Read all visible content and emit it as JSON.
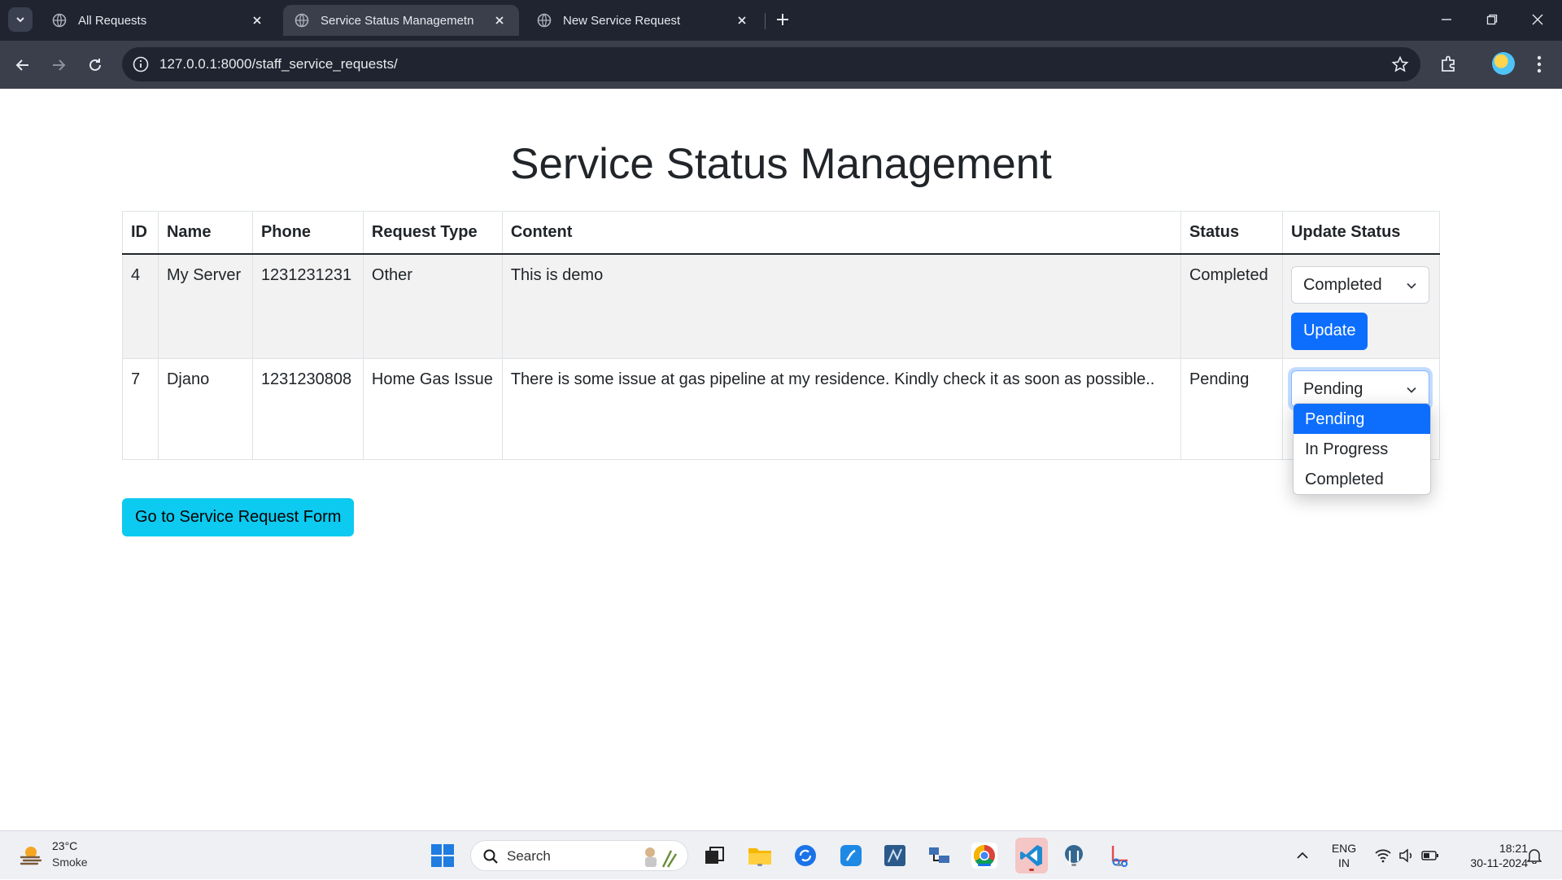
{
  "browser": {
    "tabs": [
      {
        "title": "All Requests",
        "active": false
      },
      {
        "title": "Service Status Managemetn",
        "active": true
      },
      {
        "title": "New Service Request",
        "active": false
      }
    ],
    "url": "127.0.0.1:8000/staff_service_requests/"
  },
  "page": {
    "title": "Service Status Management",
    "table": {
      "headers": [
        "ID",
        "Name",
        "Phone",
        "Request Type",
        "Content",
        "Status",
        "Update Status"
      ],
      "rows": [
        {
          "id": "4",
          "name": "My Server",
          "phone": "1231231231",
          "request_type": "Other",
          "content": "This is demo",
          "status": "Completed",
          "selected": "Completed",
          "update_label": "Update"
        },
        {
          "id": "7",
          "name": "Djano",
          "phone": "1231230808",
          "request_type": "Home Gas Issue",
          "content": "There is some issue at gas pipeline at my residence. Kindly check it as soon as possible..",
          "status": "Pending",
          "selected": "Pending"
        }
      ]
    },
    "dropdown_options": [
      "Pending",
      "In Progress",
      "Completed"
    ],
    "form_button": "Go to Service Request Form"
  },
  "taskbar": {
    "weather": {
      "temp": "23°C",
      "desc": "Smoke"
    },
    "search_label": "Search",
    "lang": {
      "line1": "ENG",
      "line2": "IN"
    },
    "clock": {
      "time": "18:21",
      "date": "30-11-2024"
    }
  },
  "colors": {
    "primary": "#0d6efd",
    "info": "#0dcaf0",
    "chrome_dark": "#1f2430"
  }
}
